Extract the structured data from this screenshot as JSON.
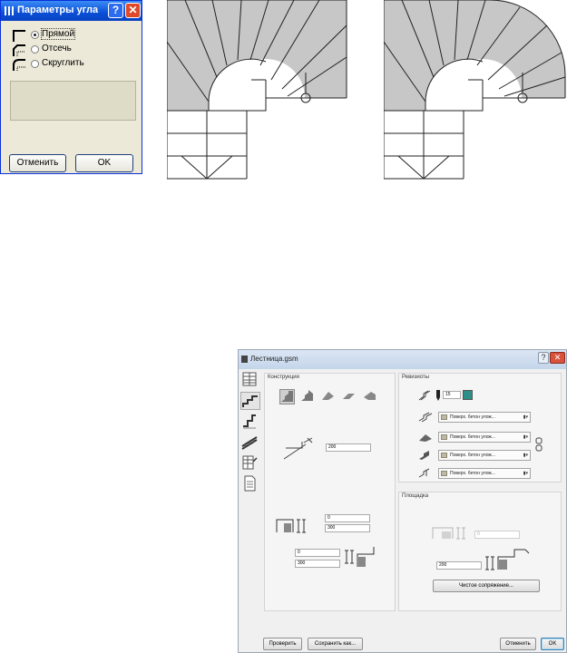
{
  "corner_dialog": {
    "title": "Параметры угла",
    "options": [
      {
        "label": "Прямой",
        "selected": true
      },
      {
        "label": "Отсечь",
        "selected": false
      },
      {
        "label": "Скруглить",
        "selected": false
      }
    ],
    "cancel_label": "Отменить",
    "ok_label": "OK"
  },
  "stair_dialog": {
    "title": "Лестница.gsm",
    "sidebar_tabs": [
      "stair-plan-icon",
      "stair-construction-icon",
      "step-icon",
      "railing-icon",
      "table-icon",
      "document-icon"
    ],
    "construction": {
      "label": "Конструкция",
      "value_200": "200",
      "field_0_a": "0",
      "field_300_a": "300",
      "field_0_b": "0",
      "field_300_b": "300"
    },
    "stringers": {
      "label": "Ревизиоты",
      "number_value": "15",
      "materials": [
        "Поверх. бетон улож...",
        "Поверх. бетон улож...",
        "Поверх. бетон улож...",
        "Поверх. бетон улож..."
      ]
    },
    "landing": {
      "label": "Площадка",
      "disabled_value": "0",
      "value_200": "200",
      "clean_joint_label": "Чистое сопряжение..."
    },
    "buttons": {
      "check": "Проверить",
      "save_as": "Сохранить как...",
      "cancel": "Отменить",
      "ok": "OK"
    }
  },
  "colors": {
    "stair_fill": "#c7c7c7",
    "xp_title": "#0a4fd6",
    "win7_title": "#c4d5ea"
  }
}
